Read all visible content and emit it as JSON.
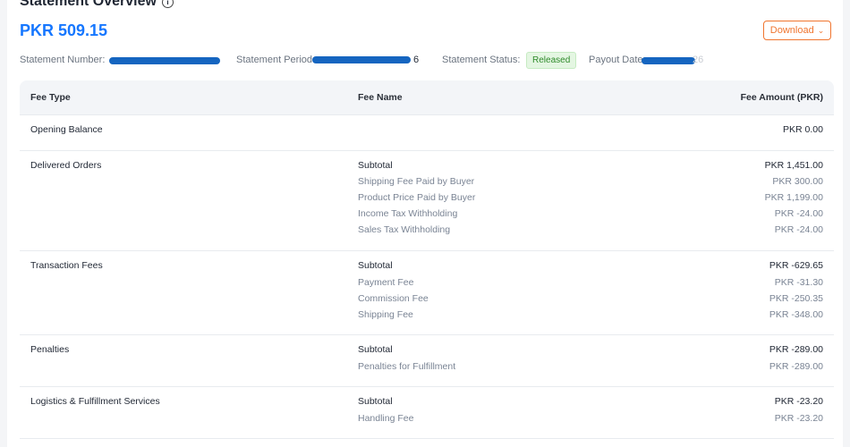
{
  "header": {
    "title": "Statement Overview",
    "amount": "PKR 509.15",
    "download_label": "Download"
  },
  "meta": {
    "statement_number_label": "Statement Number:",
    "statement_period_label": "Statement Period:",
    "statement_status_label": "Statement Status:",
    "statement_status_value": "Released",
    "payout_date_label": "Payout Date:",
    "period_tail": "6",
    "payout_tail": "26"
  },
  "table": {
    "headers": [
      "Fee Type",
      "Fee Name",
      "Fee Amount (PKR)"
    ],
    "opening": {
      "type": "Opening Balance",
      "amount": "PKR 0.00"
    },
    "delivered": {
      "type": "Delivered Orders",
      "lines": [
        [
          "Subtotal",
          "PKR 1,451.00"
        ],
        [
          "Shipping Fee Paid by Buyer",
          "PKR 300.00"
        ],
        [
          "Product Price Paid by Buyer",
          "PKR 1,199.00"
        ],
        [
          "Income Tax Withholding",
          "PKR -24.00"
        ],
        [
          "Sales Tax Withholding",
          "PKR -24.00"
        ]
      ]
    },
    "transaction": {
      "type": "Transaction Fees",
      "lines": [
        [
          "Subtotal",
          "PKR -629.65"
        ],
        [
          "Payment Fee",
          "PKR -31.30"
        ],
        [
          "Commission Fee",
          "PKR -250.35"
        ],
        [
          "Shipping Fee",
          "PKR -348.00"
        ]
      ]
    },
    "penalties": {
      "type": "Penalties",
      "lines": [
        [
          "Subtotal",
          "PKR -289.00"
        ],
        [
          "Penalties for Fulfillment",
          "PKR -289.00"
        ]
      ]
    },
    "logistics": {
      "type": "Logistics & Fulfillment Services",
      "lines": [
        [
          "Subtotal",
          "PKR -23.20"
        ],
        [
          "Handling Fee",
          "PKR -23.20"
        ]
      ]
    }
  },
  "colors": {
    "accent": "#1677ff",
    "download_border": "#f0752f",
    "redaction": "#1565c0",
    "badge_bg": "#e4f6e2",
    "badge_text": "#2f8a2b"
  }
}
